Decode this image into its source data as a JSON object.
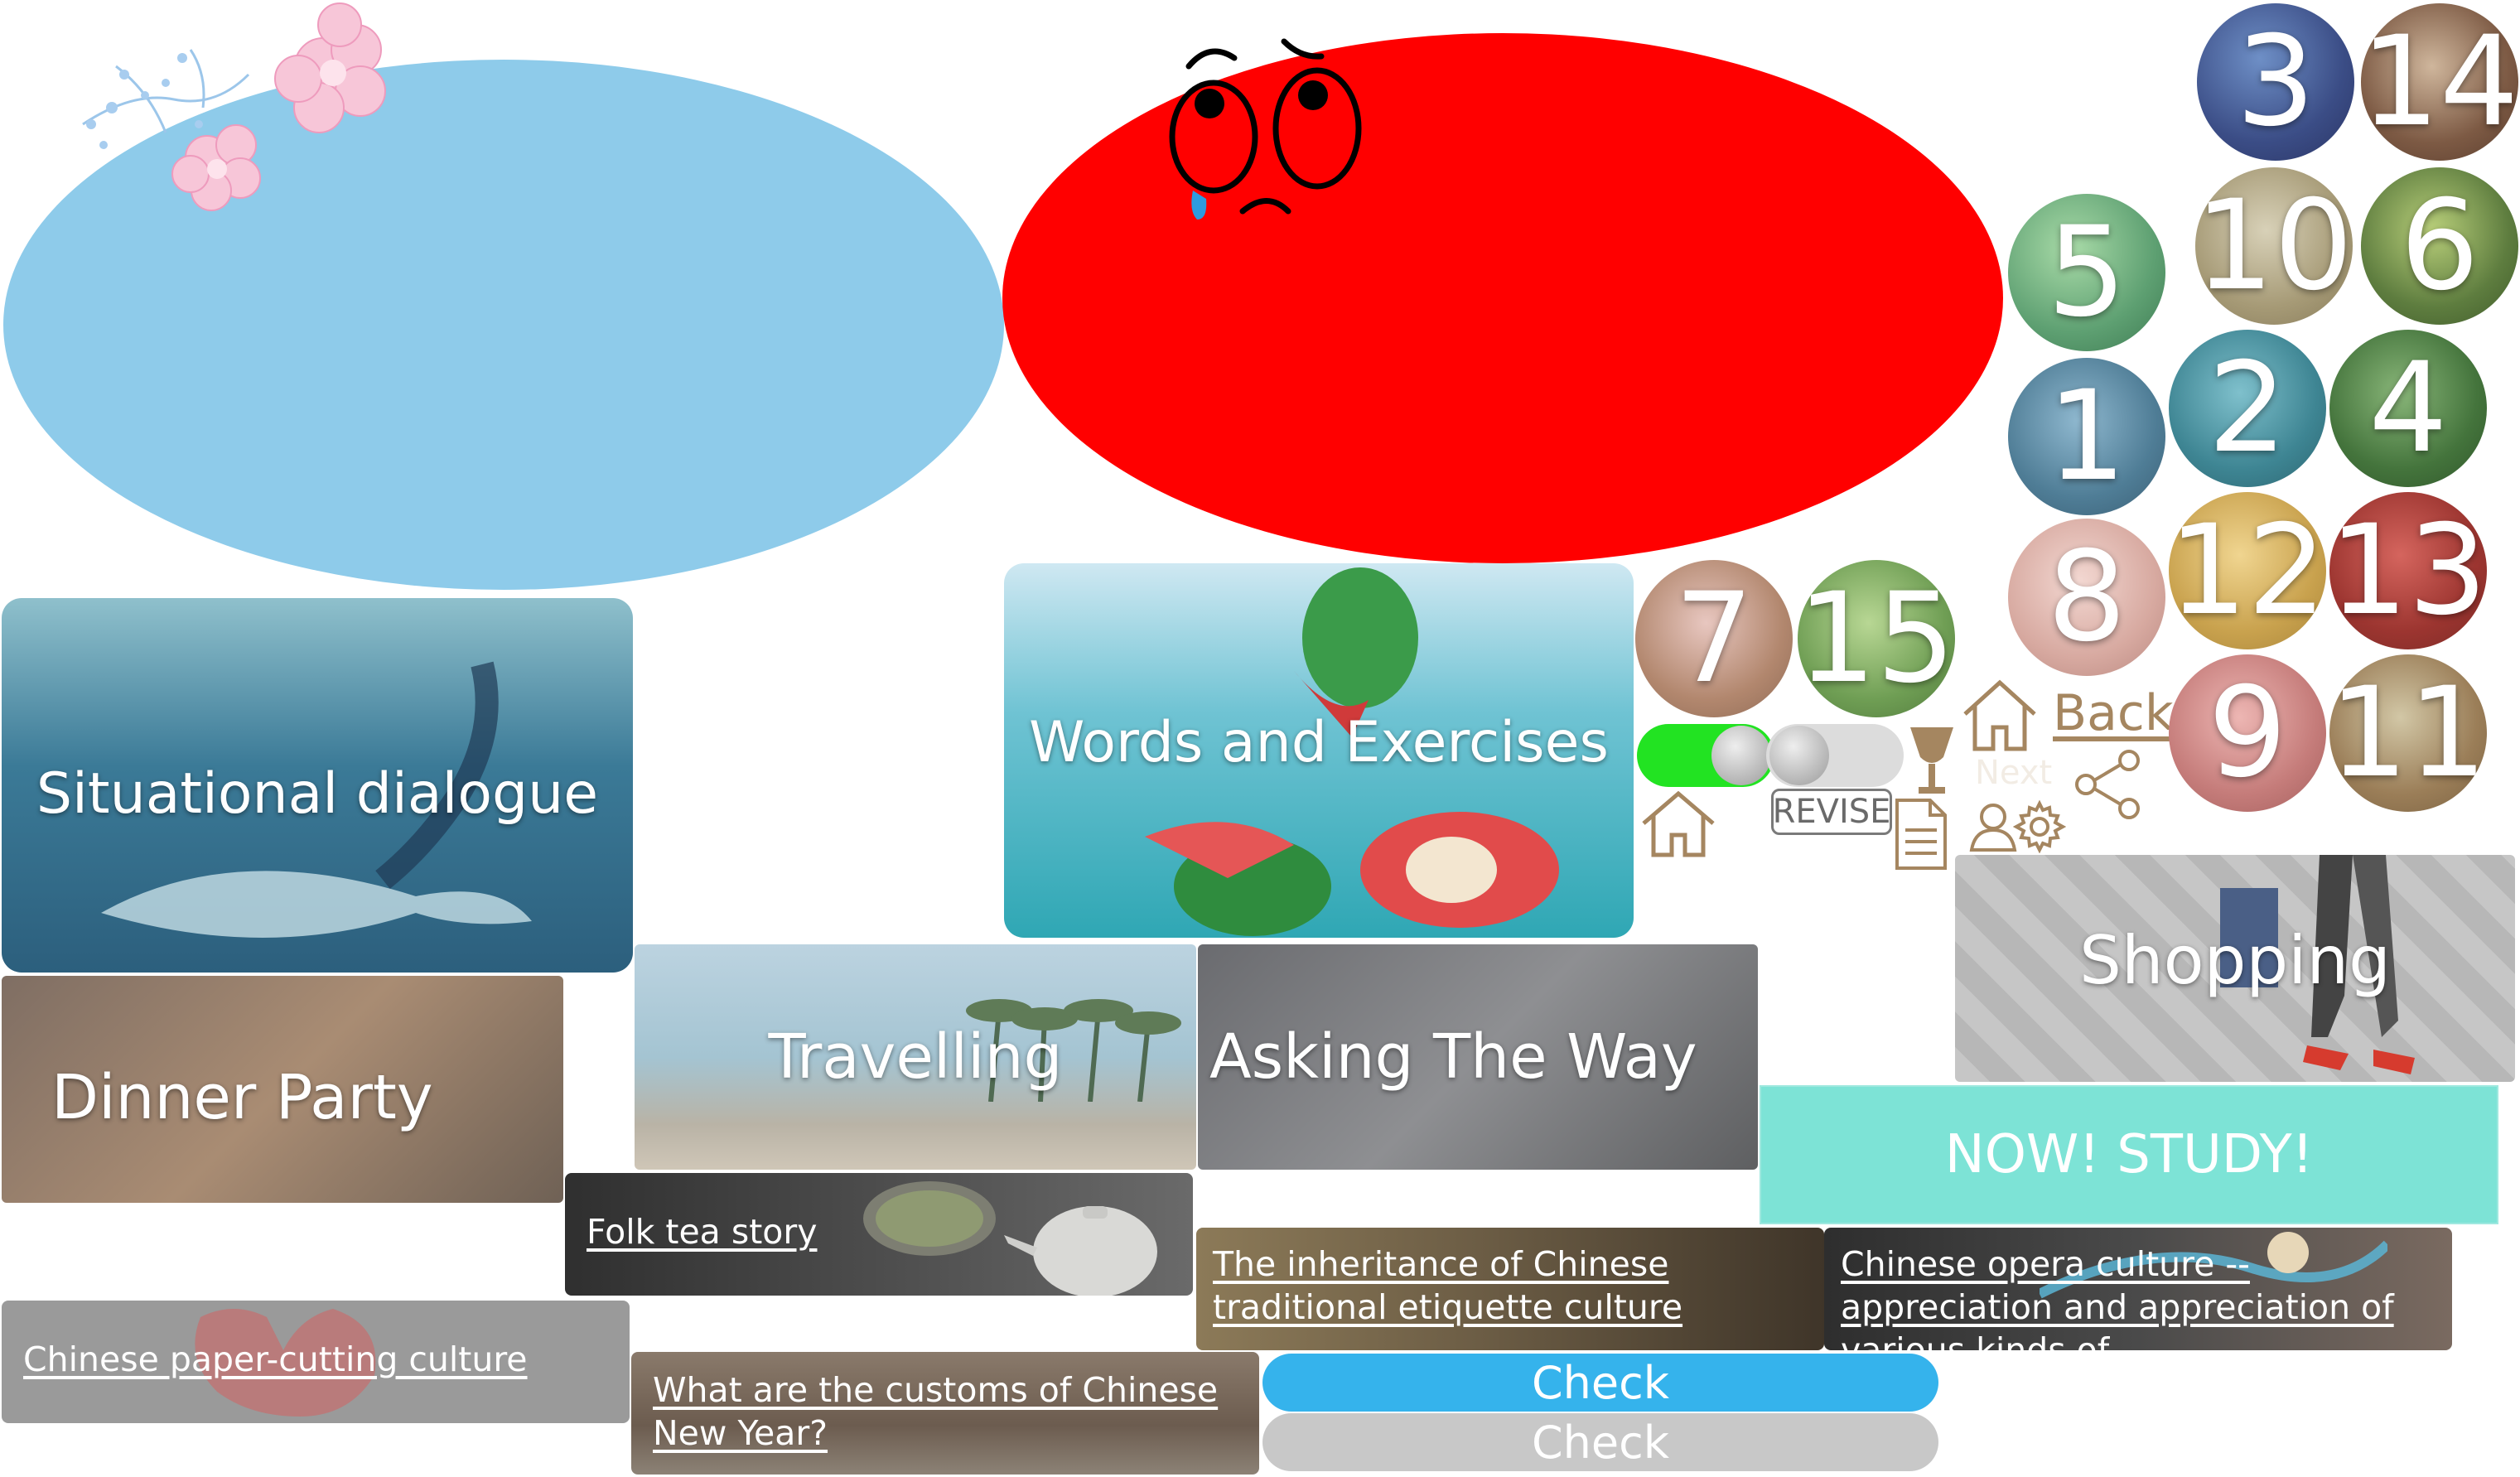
{
  "colors": {
    "sky_ellipse": "#8ecbea",
    "red_ellipse": "#ff0000",
    "check_active": "#35b3ec",
    "check_disabled": "#c8c8c8",
    "study_button": "#7de3d6",
    "brown_icon": "#a58660",
    "toggle_on": "#22e322"
  },
  "cards": {
    "situational": "Situational dialogue",
    "words": "Words and Exercises",
    "dinner": "Dinner Party",
    "travelling": "Travelling",
    "asking": "Asking The Way",
    "shopping": "Shopping"
  },
  "topics": {
    "folk_tea": "Folk tea story",
    "paper_cutting": "Chinese paper-cutting culture",
    "new_year": "What are the customs of Chinese New Year?",
    "etiquette": "The inheritance of Chinese traditional etiquette culture",
    "opera": "Chinese opera culture -- appreciation and appreciation of various kinds of"
  },
  "buttons": {
    "study": "NOW!  STUDY!",
    "check_active": "Check",
    "check_disabled": "Check",
    "back": "Back",
    "next": "Next",
    "revise": "REVISE"
  },
  "lesson_numbers": {
    "n3": "3",
    "n14": "14",
    "n5": "5",
    "n10": "10",
    "n6": "6",
    "n1": "1",
    "n2": "2",
    "n4": "4",
    "n8": "8",
    "n12": "12",
    "n13": "13",
    "n9": "9",
    "n11": "11",
    "n7": "7",
    "n15": "15"
  },
  "icons": {
    "flowers": "flowers-decoration-icon",
    "crying_face": "crying-face-icon",
    "home_large": "home-icon",
    "home_small": "home-icon",
    "trophy": "trophy-icon",
    "document": "document-icon",
    "share": "share-icon",
    "user": "user-icon",
    "gear": "gear-icon"
  }
}
